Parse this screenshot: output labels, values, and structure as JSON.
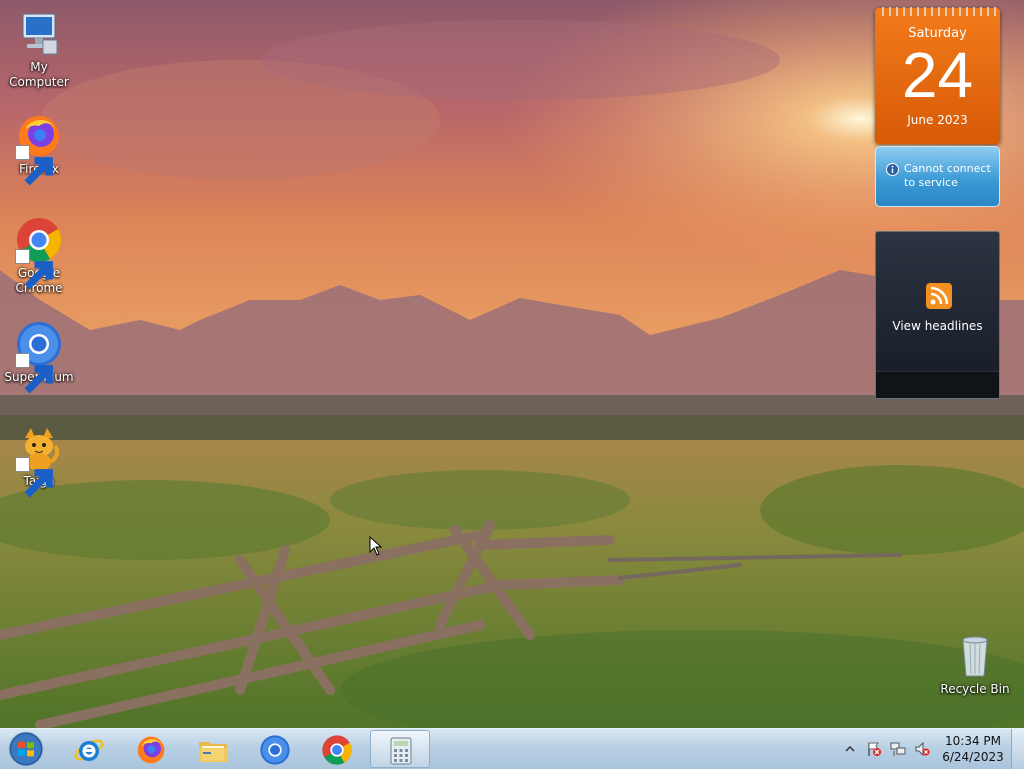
{
  "desktop_icons": [
    {
      "label": "My Computer",
      "icon": "computer-icon"
    },
    {
      "label": "Firefox",
      "icon": "firefox-icon"
    },
    {
      "label": "Google\nChrome",
      "icon": "chrome-icon"
    },
    {
      "label": "Supermium",
      "icon": "supermium-icon"
    },
    {
      "label": "Taiga",
      "icon": "taiga-icon"
    },
    {
      "label": "Recycle Bin",
      "icon": "recycle-bin-icon"
    }
  ],
  "calendar": {
    "weekday": "Saturday",
    "day": "24",
    "month_year": "June 2023"
  },
  "weather": {
    "message": "Cannot connect to service",
    "icon": "info-icon"
  },
  "feed": {
    "label": "View headlines",
    "icon": "rss-icon"
  },
  "taskbar": {
    "start_icon": "windows-start-icon",
    "pinned": [
      {
        "name": "Internet Explorer",
        "icon": "internet-explorer-icon"
      },
      {
        "name": "Firefox",
        "icon": "firefox-icon"
      },
      {
        "name": "File Explorer",
        "icon": "folder-icon"
      },
      {
        "name": "Supermium",
        "icon": "supermium-icon"
      },
      {
        "name": "Google Chrome",
        "icon": "chrome-icon"
      },
      {
        "name": "Calculator",
        "icon": "calculator-icon",
        "active": true
      }
    ],
    "tray_icons": [
      "show-hidden-icons-chevron",
      "action-center-flag-icon",
      "network-icon",
      "volume-muted-icon"
    ]
  },
  "clock": {
    "time": "10:34 PM",
    "date": "6/24/2023"
  },
  "colors": {
    "calendar_orange": "#e86a10",
    "weather_blue": "#3c9bd6",
    "feed_dark": "#1f2530",
    "taskbar": "#b9d0e4"
  }
}
